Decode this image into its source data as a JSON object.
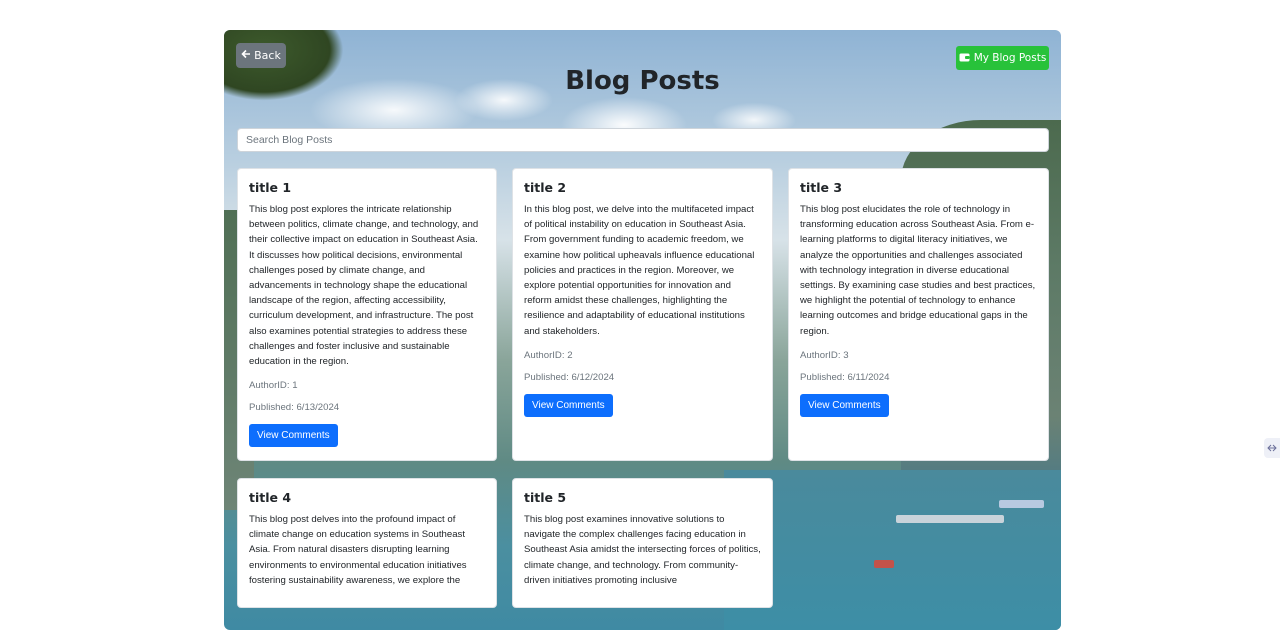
{
  "header": {
    "back_label": "Back",
    "my_posts_label": "My Blog Posts",
    "title": "Blog Posts"
  },
  "search": {
    "placeholder": "Search Blog Posts",
    "value": ""
  },
  "posts": [
    {
      "title": "title 1",
      "body": "This blog post explores the intricate relationship between politics, climate change, and technology, and their collective impact on education in Southeast Asia. It discusses how political decisions, environmental challenges posed by climate change, and advancements in technology shape the educational landscape of the region, affecting accessibility, curriculum development, and infrastructure. The post also examines potential strategies to address these challenges and foster inclusive and sustainable education in the region.",
      "author": "AuthorID: 1",
      "published": "Published: 6/13/2024",
      "button": "View Comments"
    },
    {
      "title": "title 2",
      "body": "In this blog post, we delve into the multifaceted impact of political instability on education in Southeast Asia. From government funding to academic freedom, we examine how political upheavals influence educational policies and practices in the region. Moreover, we explore potential opportunities for innovation and reform amidst these challenges, highlighting the resilience and adaptability of educational institutions and stakeholders.",
      "author": "AuthorID: 2",
      "published": "Published: 6/12/2024",
      "button": "View Comments"
    },
    {
      "title": "title 3",
      "body": "This blog post elucidates the role of technology in transforming education across Southeast Asia. From e-learning platforms to digital literacy initiatives, we analyze the opportunities and challenges associated with technology integration in diverse educational settings. By examining case studies and best practices, we highlight the potential of technology to enhance learning outcomes and bridge educational gaps in the region.",
      "author": "AuthorID: 3",
      "published": "Published: 6/11/2024",
      "button": "View Comments"
    },
    {
      "title": "title 4",
      "body": "This blog post delves into the profound impact of climate change on education systems in Southeast Asia. From natural disasters disrupting learning environments to environmental education initiatives fostering sustainability awareness, we explore the"
    },
    {
      "title": "title 5",
      "body": "This blog post examines innovative solutions to navigate the complex challenges facing education in Southeast Asia amidst the intersecting forces of politics, climate change, and technology. From community-driven initiatives promoting inclusive"
    }
  ],
  "colors": {
    "primary": "#0d6efd",
    "success": "#28c23a",
    "secondary": "#6c757d"
  },
  "icons": {
    "back": "arrow-left-icon",
    "my_posts": "wallet-icon"
  }
}
